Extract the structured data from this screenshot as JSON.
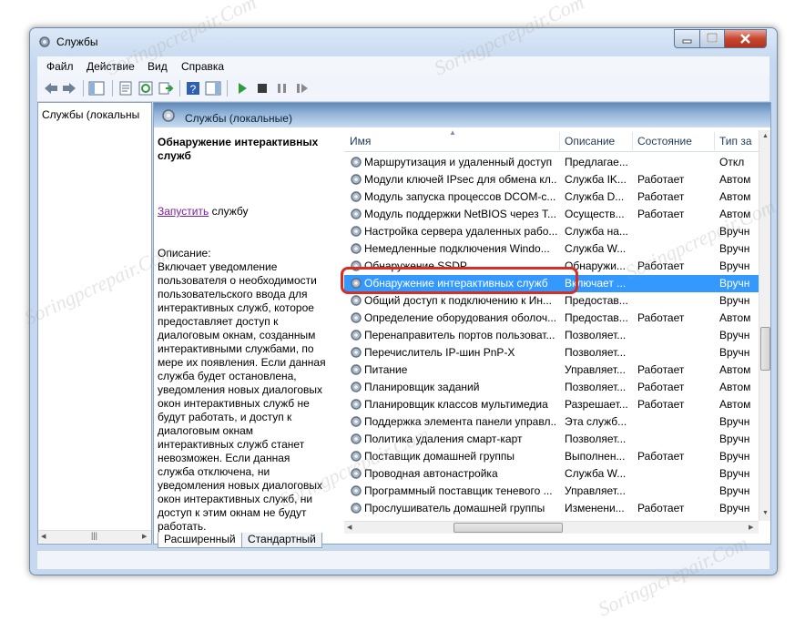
{
  "window": {
    "title": "Службы",
    "icon": "gears-icon"
  },
  "menu": [
    "Файл",
    "Действие",
    "Вид",
    "Справка"
  ],
  "left_tree": {
    "root_label": "Службы (локальны"
  },
  "pane_header": {
    "title": "Службы (локальные)"
  },
  "description": {
    "service_name": "Обнаружение интерактивных служб",
    "action_link": "Запустить",
    "action_rest": " службу",
    "label": "Описание:",
    "text": "Включает уведомление пользователя о необходимости пользовательского ввода для интерактивных служб, которое предоставляет доступ к диалоговым окнам, созданным интерактивными службами, по мере их появления. Если данная служба будет остановлена, уведомления новых диалоговых окон интерактивных служб не будут работать, и доступ к диалоговым окнам интерактивных служб станет невозможен. Если данная служба отключена, ни уведомления новых диалоговых окон интерактивных служб, ни доступ к этим окнам не будут работать."
  },
  "columns": [
    "Имя",
    "Описание",
    "Состояние",
    "Тип за"
  ],
  "services": [
    {
      "name": "Маршрутизация и удаленный доступ",
      "desc": "Предлагае...",
      "state": "",
      "type": "Откл"
    },
    {
      "name": "Модули ключей IPsec для обмена кл...",
      "desc": "Служба IK...",
      "state": "Работает",
      "type": "Автом"
    },
    {
      "name": "Модуль запуска процессов DCOM-с...",
      "desc": "Служба D...",
      "state": "Работает",
      "type": "Автом"
    },
    {
      "name": "Модуль поддержки NetBIOS через T...",
      "desc": "Осуществ...",
      "state": "Работает",
      "type": "Автом"
    },
    {
      "name": "Настройка сервера удаленных рабо...",
      "desc": "Служба на...",
      "state": "",
      "type": "Вручн"
    },
    {
      "name": "Немедленные подключения Windo...",
      "desc": "Служба W...",
      "state": "",
      "type": "Вручн"
    },
    {
      "name": "Обнаружение SSDP",
      "desc": "Обнаружи...",
      "state": "Работает",
      "type": "Вручн"
    },
    {
      "name": "Обнаружение интерактивных служб",
      "desc": "Включает ...",
      "state": "",
      "type": "Вручн",
      "selected": true
    },
    {
      "name": "Общий доступ к подключению к Ин...",
      "desc": "Предостав...",
      "state": "",
      "type": "Вручн"
    },
    {
      "name": "Определение оборудования оболоч...",
      "desc": "Предостав...",
      "state": "Работает",
      "type": "Автом"
    },
    {
      "name": "Перенаправитель портов пользоват...",
      "desc": "Позволяет...",
      "state": "",
      "type": "Вручн"
    },
    {
      "name": "Перечислитель IP-шин PnP-X",
      "desc": "Позволяет...",
      "state": "",
      "type": "Вручн"
    },
    {
      "name": "Питание",
      "desc": "Управляет...",
      "state": "Работает",
      "type": "Автом"
    },
    {
      "name": "Планировщик заданий",
      "desc": "Позволяет...",
      "state": "Работает",
      "type": "Автом"
    },
    {
      "name": "Планировщик классов мультимедиа",
      "desc": "Разрешает...",
      "state": "Работает",
      "type": "Автом"
    },
    {
      "name": "Поддержка элемента панели управл...",
      "desc": "Эта служб...",
      "state": "",
      "type": "Вручн"
    },
    {
      "name": "Политика удаления смарт-карт",
      "desc": "Позволяет...",
      "state": "",
      "type": "Вручн"
    },
    {
      "name": "Поставщик домашней группы",
      "desc": "Выполнен...",
      "state": "Работает",
      "type": "Вручн"
    },
    {
      "name": "Проводная автонастройка",
      "desc": "Служба W...",
      "state": "",
      "type": "Вручн"
    },
    {
      "name": "Программный поставщик теневого ...",
      "desc": "Управляет...",
      "state": "",
      "type": "Вручн"
    },
    {
      "name": "Прослушиватель домашней группы",
      "desc": "Изменени...",
      "state": "Работает",
      "type": "Вручн"
    }
  ],
  "tabs": [
    "Расширенный",
    "Стандартный"
  ],
  "watermark": "Soringpcrepair.Com",
  "colors": {
    "selection": "#3399ff",
    "highlight_box": "#d62d25",
    "link": "#7b1fa0"
  }
}
